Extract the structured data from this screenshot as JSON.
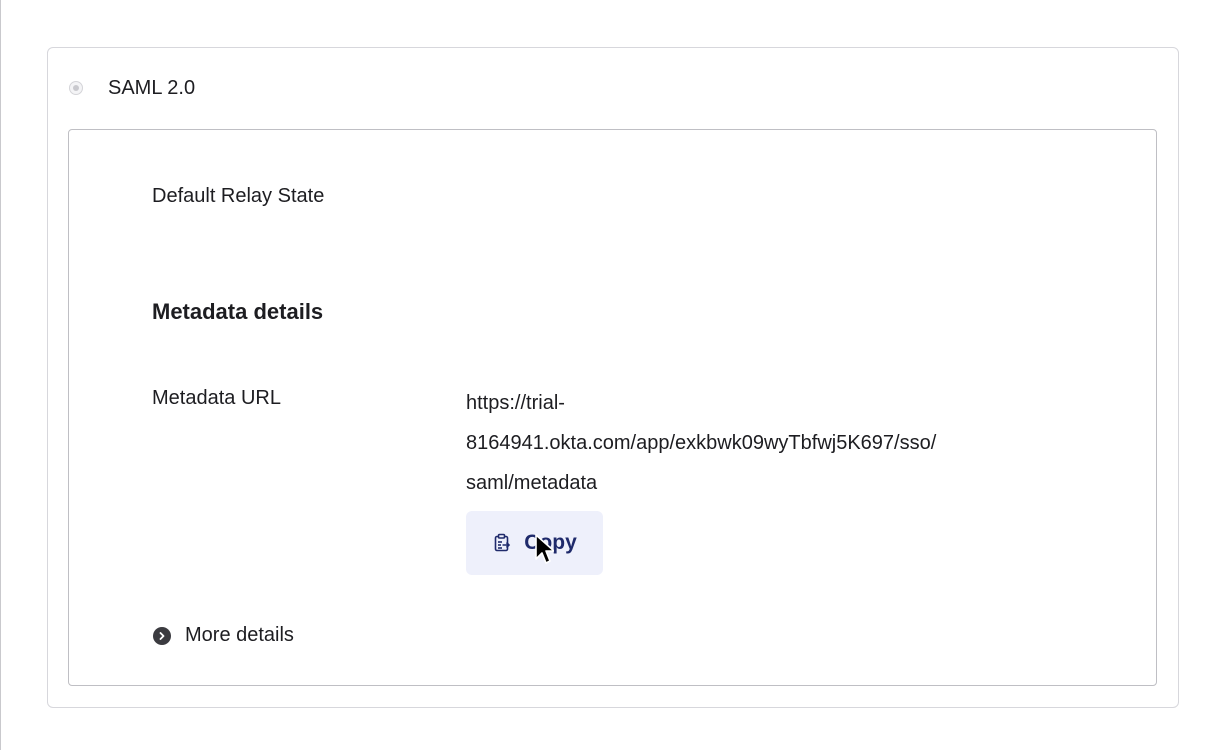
{
  "saml_section": {
    "radio_label": "SAML 2.0",
    "radio_selected": false,
    "relay_state_label": "Default Relay State",
    "metadata": {
      "title": "Metadata details",
      "url_label": "Metadata URL",
      "url_lines": [
        "https://trial-",
        "8164941.okta.com/app/exkbwk09wyTbfwj5K697/sso/",
        "saml/metadata"
      ],
      "copy_label": "Copy",
      "copy_icon": "clipboard-icon"
    },
    "more_details": {
      "label": "More details",
      "icon": "chevron-right-circle-icon"
    }
  },
  "colors": {
    "copy_button_bg": "#eef0fb",
    "copy_text": "#1f2a6b",
    "border": "#d7d7dc"
  }
}
